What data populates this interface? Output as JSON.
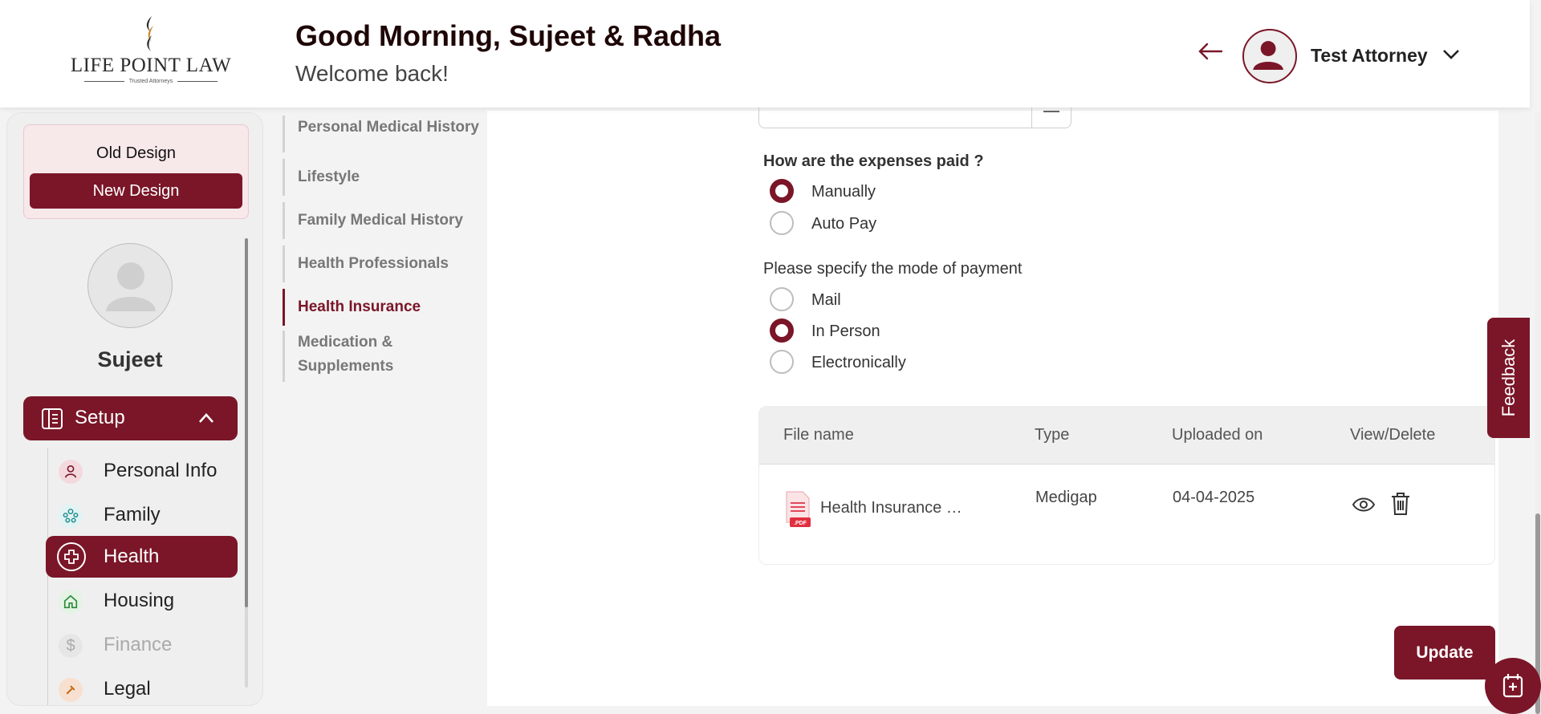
{
  "header": {
    "logo": {
      "name": "LIFE POINT LAW",
      "tagline": "Trusted Attorneys"
    },
    "greeting": "Good Morning, Sujeet & Radha",
    "welcome": "Welcome back!",
    "profile_name": "Test Attorney"
  },
  "sidebar": {
    "old_design": "Old Design",
    "new_design": "New Design",
    "user_name": "Sujeet",
    "setup_label": "Setup",
    "items": [
      {
        "label": "Personal Info",
        "icon": "person-icon"
      },
      {
        "label": "Family",
        "icon": "family-icon"
      },
      {
        "label": "Health",
        "icon": "health-plus-icon",
        "active": true
      },
      {
        "label": "Housing",
        "icon": "home-icon"
      },
      {
        "label": "Finance",
        "icon": "dollar-icon",
        "disabled": true
      },
      {
        "label": "Legal",
        "icon": "legal-icon"
      }
    ]
  },
  "section_nav": {
    "items": [
      "Personal Medical History",
      "Lifestyle",
      "Family Medical History",
      "Health Professionals",
      "Health Insurance",
      "Medication &",
      "Supplements"
    ]
  },
  "form": {
    "expenses_question": "How are the expenses paid ?",
    "expenses_options": [
      "Manually",
      "Auto Pay"
    ],
    "expenses_selected": "Manually",
    "payment_question": "Please specify the mode of payment",
    "payment_options": [
      "Mail",
      "In Person",
      "Electronically"
    ],
    "payment_selected": "In Person"
  },
  "files_table": {
    "headers": [
      "File name",
      "Type",
      "Uploaded on",
      "View/Delete"
    ],
    "rows": [
      {
        "file_name": "Health Insurance …",
        "type": "Medigap",
        "uploaded_on": "04-04-2025"
      }
    ]
  },
  "buttons": {
    "update": "Update",
    "feedback": "Feedback"
  },
  "colors": {
    "accent": "#7a1628",
    "header_text": "#1e0606"
  }
}
